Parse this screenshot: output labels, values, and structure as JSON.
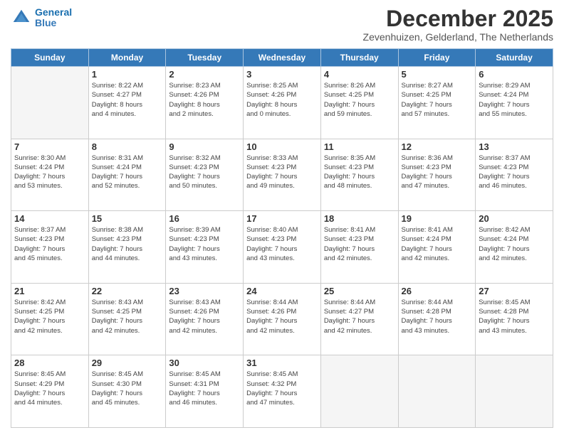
{
  "logo": {
    "line1": "General",
    "line2": "Blue"
  },
  "title": "December 2025",
  "subtitle": "Zevenhuizen, Gelderland, The Netherlands",
  "days_header": [
    "Sunday",
    "Monday",
    "Tuesday",
    "Wednesday",
    "Thursday",
    "Friday",
    "Saturday"
  ],
  "weeks": [
    [
      {
        "day": "",
        "info": ""
      },
      {
        "day": "1",
        "info": "Sunrise: 8:22 AM\nSunset: 4:27 PM\nDaylight: 8 hours\nand 4 minutes."
      },
      {
        "day": "2",
        "info": "Sunrise: 8:23 AM\nSunset: 4:26 PM\nDaylight: 8 hours\nand 2 minutes."
      },
      {
        "day": "3",
        "info": "Sunrise: 8:25 AM\nSunset: 4:26 PM\nDaylight: 8 hours\nand 0 minutes."
      },
      {
        "day": "4",
        "info": "Sunrise: 8:26 AM\nSunset: 4:25 PM\nDaylight: 7 hours\nand 59 minutes."
      },
      {
        "day": "5",
        "info": "Sunrise: 8:27 AM\nSunset: 4:25 PM\nDaylight: 7 hours\nand 57 minutes."
      },
      {
        "day": "6",
        "info": "Sunrise: 8:29 AM\nSunset: 4:24 PM\nDaylight: 7 hours\nand 55 minutes."
      }
    ],
    [
      {
        "day": "7",
        "info": "Sunrise: 8:30 AM\nSunset: 4:24 PM\nDaylight: 7 hours\nand 53 minutes."
      },
      {
        "day": "8",
        "info": "Sunrise: 8:31 AM\nSunset: 4:24 PM\nDaylight: 7 hours\nand 52 minutes."
      },
      {
        "day": "9",
        "info": "Sunrise: 8:32 AM\nSunset: 4:23 PM\nDaylight: 7 hours\nand 50 minutes."
      },
      {
        "day": "10",
        "info": "Sunrise: 8:33 AM\nSunset: 4:23 PM\nDaylight: 7 hours\nand 49 minutes."
      },
      {
        "day": "11",
        "info": "Sunrise: 8:35 AM\nSunset: 4:23 PM\nDaylight: 7 hours\nand 48 minutes."
      },
      {
        "day": "12",
        "info": "Sunrise: 8:36 AM\nSunset: 4:23 PM\nDaylight: 7 hours\nand 47 minutes."
      },
      {
        "day": "13",
        "info": "Sunrise: 8:37 AM\nSunset: 4:23 PM\nDaylight: 7 hours\nand 46 minutes."
      }
    ],
    [
      {
        "day": "14",
        "info": "Sunrise: 8:37 AM\nSunset: 4:23 PM\nDaylight: 7 hours\nand 45 minutes."
      },
      {
        "day": "15",
        "info": "Sunrise: 8:38 AM\nSunset: 4:23 PM\nDaylight: 7 hours\nand 44 minutes."
      },
      {
        "day": "16",
        "info": "Sunrise: 8:39 AM\nSunset: 4:23 PM\nDaylight: 7 hours\nand 43 minutes."
      },
      {
        "day": "17",
        "info": "Sunrise: 8:40 AM\nSunset: 4:23 PM\nDaylight: 7 hours\nand 43 minutes."
      },
      {
        "day": "18",
        "info": "Sunrise: 8:41 AM\nSunset: 4:23 PM\nDaylight: 7 hours\nand 42 minutes."
      },
      {
        "day": "19",
        "info": "Sunrise: 8:41 AM\nSunset: 4:24 PM\nDaylight: 7 hours\nand 42 minutes."
      },
      {
        "day": "20",
        "info": "Sunrise: 8:42 AM\nSunset: 4:24 PM\nDaylight: 7 hours\nand 42 minutes."
      }
    ],
    [
      {
        "day": "21",
        "info": "Sunrise: 8:42 AM\nSunset: 4:25 PM\nDaylight: 7 hours\nand 42 minutes."
      },
      {
        "day": "22",
        "info": "Sunrise: 8:43 AM\nSunset: 4:25 PM\nDaylight: 7 hours\nand 42 minutes."
      },
      {
        "day": "23",
        "info": "Sunrise: 8:43 AM\nSunset: 4:26 PM\nDaylight: 7 hours\nand 42 minutes."
      },
      {
        "day": "24",
        "info": "Sunrise: 8:44 AM\nSunset: 4:26 PM\nDaylight: 7 hours\nand 42 minutes."
      },
      {
        "day": "25",
        "info": "Sunrise: 8:44 AM\nSunset: 4:27 PM\nDaylight: 7 hours\nand 42 minutes."
      },
      {
        "day": "26",
        "info": "Sunrise: 8:44 AM\nSunset: 4:28 PM\nDaylight: 7 hours\nand 43 minutes."
      },
      {
        "day": "27",
        "info": "Sunrise: 8:45 AM\nSunset: 4:28 PM\nDaylight: 7 hours\nand 43 minutes."
      }
    ],
    [
      {
        "day": "28",
        "info": "Sunrise: 8:45 AM\nSunset: 4:29 PM\nDaylight: 7 hours\nand 44 minutes."
      },
      {
        "day": "29",
        "info": "Sunrise: 8:45 AM\nSunset: 4:30 PM\nDaylight: 7 hours\nand 45 minutes."
      },
      {
        "day": "30",
        "info": "Sunrise: 8:45 AM\nSunset: 4:31 PM\nDaylight: 7 hours\nand 46 minutes."
      },
      {
        "day": "31",
        "info": "Sunrise: 8:45 AM\nSunset: 4:32 PM\nDaylight: 7 hours\nand 47 minutes."
      },
      {
        "day": "",
        "info": ""
      },
      {
        "day": "",
        "info": ""
      },
      {
        "day": "",
        "info": ""
      }
    ]
  ]
}
